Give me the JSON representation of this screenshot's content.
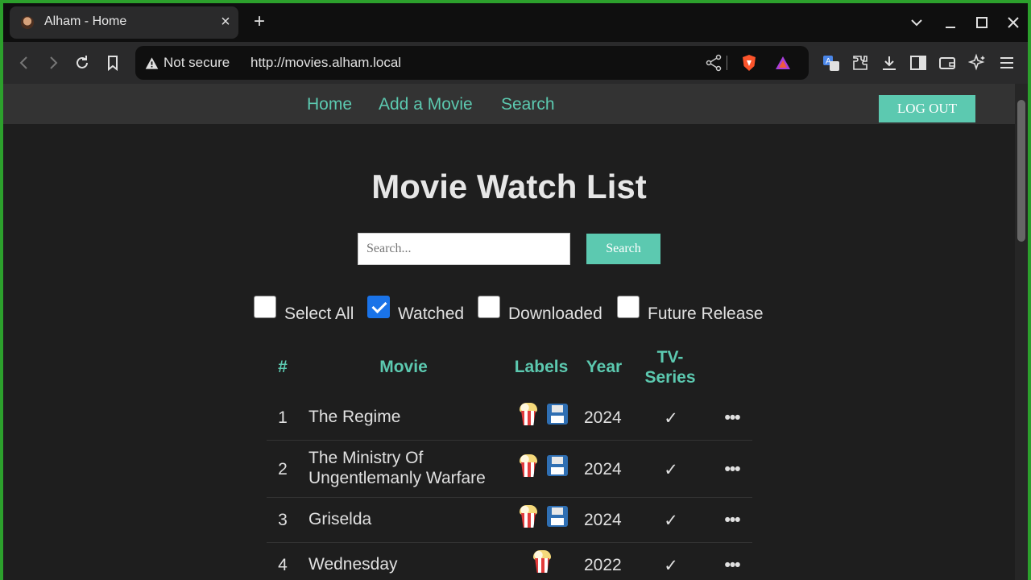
{
  "browser": {
    "tab_title": "Alham - Home",
    "security_label": "Not secure",
    "url": "http://movies.alham.local"
  },
  "nav": {
    "home": "Home",
    "add_movie": "Add a Movie",
    "search": "Search",
    "logout": "LOG OUT"
  },
  "page": {
    "title": "Movie Watch List",
    "search_placeholder": "Search...",
    "search_button": "Search"
  },
  "filters": [
    {
      "label": "Select All",
      "checked": false
    },
    {
      "label": "Watched",
      "checked": true
    },
    {
      "label": "Downloaded",
      "checked": false
    },
    {
      "label": "Future Release",
      "checked": false
    }
  ],
  "table": {
    "headers": {
      "num": "#",
      "movie": "Movie",
      "labels": "Labels",
      "year": "Year",
      "tv_line1": "TV-",
      "tv_line2": "Series"
    },
    "rows": [
      {
        "num": "1",
        "movie": "The Regime",
        "labels": [
          "popcorn-icon",
          "floppy-disk-icon"
        ],
        "year": "2024",
        "tv": "✓",
        "more": "•••"
      },
      {
        "num": "2",
        "movie_line1": "The Ministry Of",
        "movie_line2": "Ungentlemanly Warfare",
        "labels": [
          "popcorn-icon",
          "floppy-disk-icon"
        ],
        "year": "2024",
        "tv": "✓",
        "more": "•••"
      },
      {
        "num": "3",
        "movie": "Griselda",
        "labels": [
          "popcorn-icon",
          "floppy-disk-icon"
        ],
        "year": "2024",
        "tv": "✓",
        "more": "•••"
      },
      {
        "num": "4",
        "movie": "Wednesday",
        "labels": [
          "popcorn-icon"
        ],
        "year": "2022",
        "tv": "✓",
        "more": "•••"
      }
    ]
  },
  "colors": {
    "accent": "#5cc9b0",
    "page_bg": "#1e1e1e",
    "navbar_bg": "#333333",
    "checkbox_checked": "#1a73e8"
  }
}
